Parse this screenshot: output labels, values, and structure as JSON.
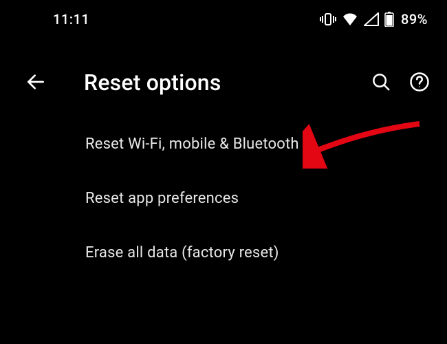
{
  "status": {
    "time": "11:11",
    "battery": "89%"
  },
  "header": {
    "title": "Reset options"
  },
  "items": [
    {
      "label": "Reset Wi-Fi, mobile & Bluetooth"
    },
    {
      "label": "Reset app preferences"
    },
    {
      "label": "Erase all data (factory reset)"
    }
  ]
}
